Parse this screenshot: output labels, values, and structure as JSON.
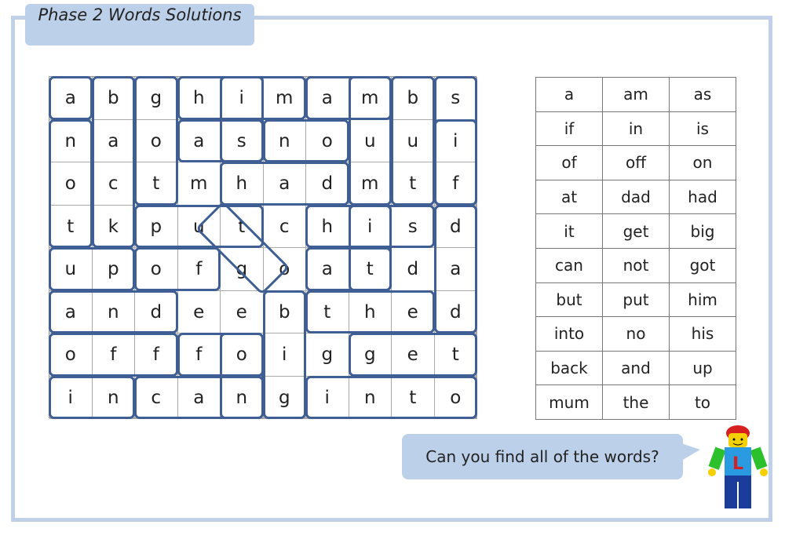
{
  "title": "Phase 2 Words Solutions",
  "grid": [
    [
      "a",
      "b",
      "g",
      "h",
      "i",
      "m",
      "a",
      "m",
      "b",
      "s"
    ],
    [
      "n",
      "a",
      "o",
      "a",
      "s",
      "n",
      "o",
      "u",
      "u",
      "i"
    ],
    [
      "o",
      "c",
      "t",
      "m",
      "h",
      "a",
      "d",
      "m",
      "t",
      "f"
    ],
    [
      "t",
      "k",
      "p",
      "u",
      "t",
      "c",
      "h",
      "i",
      "s",
      "d"
    ],
    [
      "u",
      "p",
      "o",
      "f",
      "g",
      "o",
      "a",
      "t",
      "d",
      "a"
    ],
    [
      "a",
      "n",
      "d",
      "e",
      "e",
      "b",
      "t",
      "h",
      "e",
      "d"
    ],
    [
      "o",
      "f",
      "f",
      "f",
      "o",
      "i",
      "g",
      "g",
      "e",
      "t"
    ],
    [
      "i",
      "n",
      "c",
      "a",
      "n",
      "g",
      "i",
      "n",
      "t",
      "o"
    ]
  ],
  "word_list": [
    [
      "a",
      "am",
      "as"
    ],
    [
      "if",
      "in",
      "is"
    ],
    [
      "of",
      "off",
      "on"
    ],
    [
      "at",
      "dad",
      "had"
    ],
    [
      "it",
      "get",
      "big"
    ],
    [
      "can",
      "not",
      "got"
    ],
    [
      "but",
      "put",
      "him"
    ],
    [
      "into",
      "no",
      "his"
    ],
    [
      "back",
      "and",
      "up"
    ],
    [
      "mum",
      "the",
      "to"
    ]
  ],
  "bubble_text": "Can you find all of the words?",
  "highlight_color": "#3f5f94",
  "mascot_letter": "L"
}
